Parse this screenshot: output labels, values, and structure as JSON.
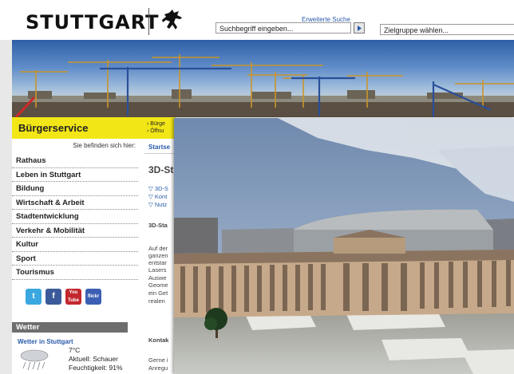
{
  "header": {
    "logo_text": "STUTTGART",
    "advanced_search": "Erweiterte Suche",
    "search_placeholder": "Suchbegriff eingeben...",
    "target_group": "Zielgruppe wählen..."
  },
  "service": {
    "title": "Bürgerservice",
    "links": [
      "› Bürge",
      "› Öffnu"
    ]
  },
  "breadcrumb": {
    "label": "Sie befinden sich hier:",
    "start": "Startse"
  },
  "nav": {
    "items": [
      "Rathaus",
      "Leben in Stuttgart",
      "Bildung",
      "Wirtschaft & Arbeit",
      "Stadtentwicklung",
      "Verkehr & Mobilität",
      "Kultur",
      "Sport",
      "Tourismus"
    ]
  },
  "social": [
    "t",
    "f",
    "You Tube",
    "flickr"
  ],
  "weather": {
    "title": "Wetter",
    "city": "Wetter in Stuttgart",
    "temp": "7°C",
    "current": "Aktuell: Schauer",
    "humidity": "Feuchtigkeit: 91%"
  },
  "content": {
    "title": "3D-St",
    "links": [
      "▽ 3D-S",
      "▽ Kont",
      "▽ Nutz"
    ],
    "subheading": "3D-Sta",
    "text_lines": [
      "Auf der",
      "ganzen",
      "entstar",
      "Lasers",
      "Auswe",
      "Geome",
      "ein Get",
      "realen"
    ],
    "contact": "Kontak",
    "contact_lines": [
      "Gerne i",
      "Anregu"
    ]
  },
  "colors": {
    "accent_yellow": "#f3e617",
    "link_blue": "#2a5aa8",
    "weather_bar": "#6e6e6e"
  }
}
